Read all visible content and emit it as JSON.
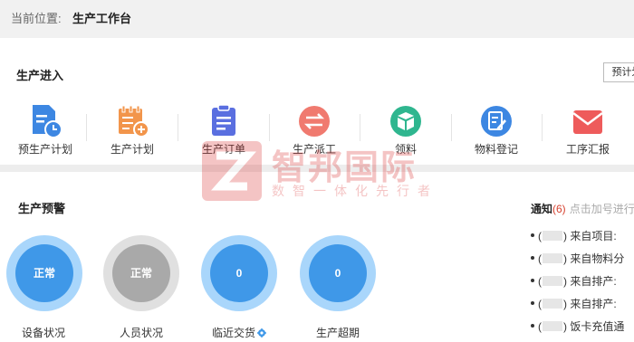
{
  "breadcrumb": {
    "label": "当前位置:",
    "current": "生产工作台"
  },
  "entry": {
    "title": "生产进入",
    "plan_button": "预计划",
    "items": [
      {
        "label": "预生产计划",
        "icon": "doc-clock-icon",
        "color": "#3d87e2"
      },
      {
        "label": "生产计划",
        "icon": "calendar-plus-icon",
        "color": "#f2954b"
      },
      {
        "label": "生产订单",
        "icon": "clipboard-icon",
        "color": "#5a6fe0"
      },
      {
        "label": "生产派工",
        "icon": "swap-arrows-icon",
        "color": "#f07a6f"
      },
      {
        "label": "领料",
        "icon": "box-icon",
        "color": "#2fb68f"
      },
      {
        "label": "物料登记",
        "icon": "edit-doc-icon",
        "color": "#3d87e2"
      },
      {
        "label": "工序汇报",
        "icon": "mail-icon",
        "color": "#ee5b5b"
      }
    ]
  },
  "warning": {
    "title": "生产预警",
    "gauges": [
      {
        "label": "设备状况",
        "value": "正常",
        "style": "blue"
      },
      {
        "label": "人员状况",
        "value": "正常",
        "style": "grey"
      },
      {
        "label": "临近交货",
        "value": "0",
        "style": "blue",
        "gear": true
      },
      {
        "label": "生产超期",
        "value": "0",
        "style": "blue"
      }
    ]
  },
  "notice": {
    "title": "通知",
    "count": "(6)",
    "hint": "点击加号进行",
    "items": [
      "来自项目:",
      "来自物料分",
      "来自排产:",
      "来自排产:",
      "饭卡充值通"
    ]
  },
  "watermark": {
    "brand": "智邦国际",
    "slogan": "数智一体化先行者"
  },
  "colors": {
    "gauge_blue": "#3f98e8",
    "gauge_blue_ring": "#a9d6fb",
    "gauge_grey": "#a9a9a9",
    "notice_count": "#d6412f"
  }
}
